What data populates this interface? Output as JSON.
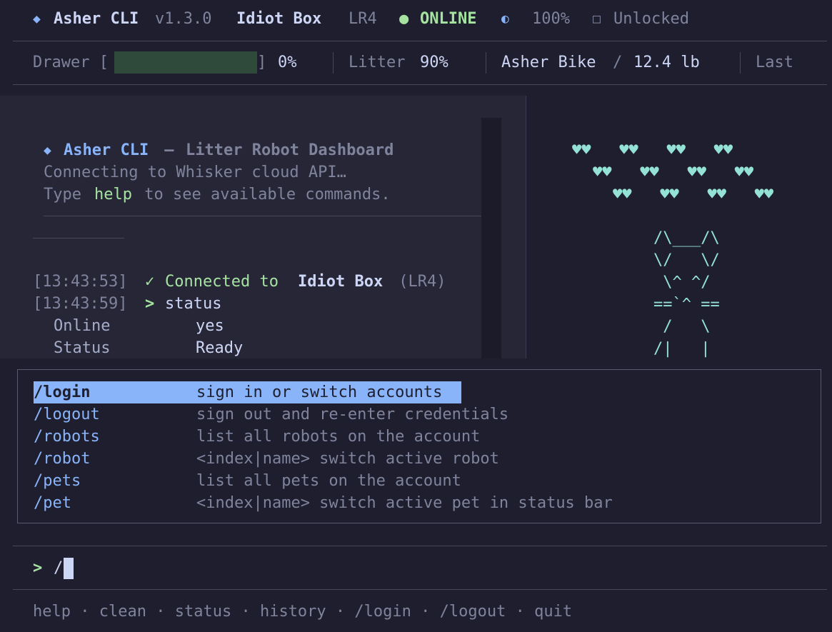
{
  "header": {
    "app_icon": "diamond-icon",
    "app_name": "Asher CLI",
    "version": "v1.3.0",
    "robot_name": "Idiot Box",
    "robot_model": "LR4",
    "status_dot": "●",
    "status_text": "ONLINE",
    "power_icon": "◐",
    "power_value": "100%",
    "lock_icon": "□",
    "lock_text": "Unlocked"
  },
  "statusbar": {
    "drawer_label": "Drawer [",
    "drawer_close": "]",
    "drawer_value": "0%",
    "litter_label": "Litter",
    "litter_value": "90%",
    "pet_name": "Asher Bike",
    "pet_sep": "/",
    "pet_weight": "12.4 lb",
    "last_label": "Last",
    "drawer_fill_fraction": 1.0
  },
  "log": {
    "banner_icon": "◆",
    "banner_title": "Asher CLI",
    "banner_dash": " — ",
    "banner_subtitle": "Litter Robot Dashboard",
    "connecting": "Connecting to Whisker cloud API…",
    "type_prefix": "Type ",
    "type_cmd": "help",
    "type_suffix": " to see available commands.",
    "lines": [
      {
        "time": "[13:43:53]",
        "mark": "✓",
        "pre": "Connected to ",
        "bold": "Idiot Box",
        "post": " (LR4)"
      },
      {
        "time": "[13:43:59]",
        "mark": ">",
        "pre": "status",
        "bold": "",
        "post": ""
      }
    ],
    "kv": [
      {
        "key": "Online",
        "value": "yes"
      },
      {
        "key": "Status",
        "value": "Ready"
      }
    ]
  },
  "art": {
    "hearts": [
      "♥♥   ♥♥   ♥♥   ♥♥",
      "♥♥   ♥♥   ♥♥   ♥♥",
      "♥♥   ♥♥   ♥♥   ♥♥"
    ],
    "cat": [
      "/\\___/\\",
      "\\/   \\/",
      " \\^ ^/",
      "==`^ ==",
      " /   \\",
      "/|   |"
    ]
  },
  "menu": {
    "items": [
      {
        "cmd": "/login",
        "desc": "sign in or switch accounts"
      },
      {
        "cmd": "/logout",
        "desc": "sign out and re-enter credentials"
      },
      {
        "cmd": "/robots",
        "desc": "list all robots on the account"
      },
      {
        "cmd": "/robot",
        "desc": "<index|name> switch active robot"
      },
      {
        "cmd": "/pets",
        "desc": "list all pets on the account"
      },
      {
        "cmd": "/pet",
        "desc": "<index|name> switch active pet in status bar"
      }
    ]
  },
  "prompt": {
    "symbol": ">",
    "value": "/"
  },
  "footer": {
    "items": [
      "help",
      "clean",
      "status",
      "history",
      "/login",
      "/logout",
      "quit"
    ],
    "sep": "·"
  },
  "colors": {
    "accent": "#89b4fa",
    "online": "#a6e3a1",
    "art": "#94e2d5",
    "selection": "#89b4fa"
  }
}
